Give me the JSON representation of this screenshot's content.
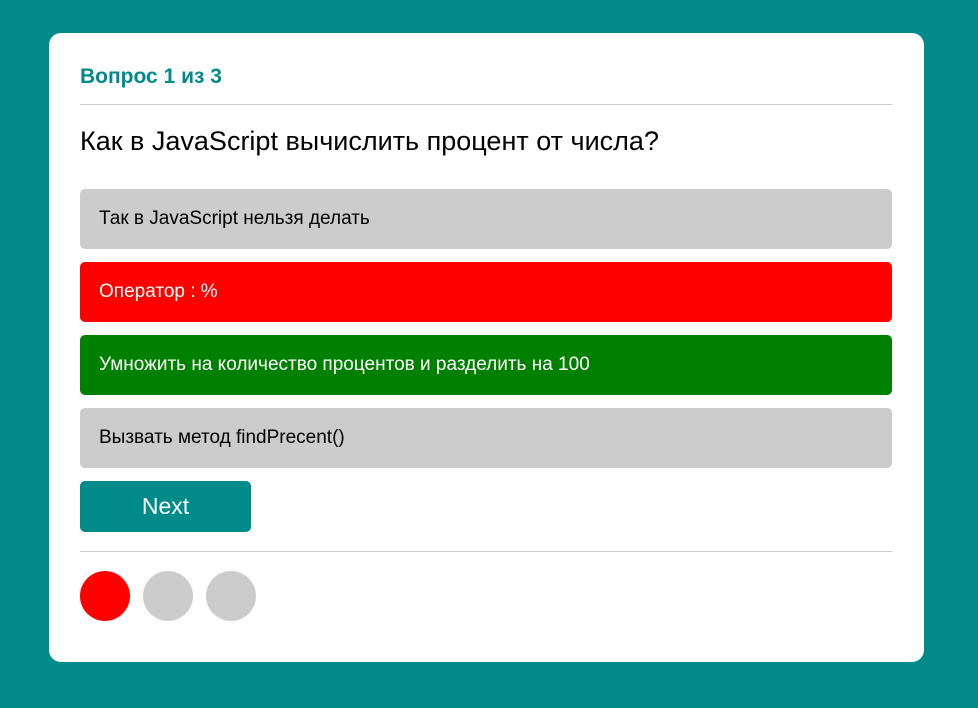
{
  "quiz": {
    "counter": "Вопрос 1 из 3",
    "question": "Как в JavaScript вычислить процент от числа?",
    "options": [
      {
        "label": "Так в JavaScript нельзя делать",
        "state": "neutral"
      },
      {
        "label": "Оператор : %",
        "state": "wrong"
      },
      {
        "label": "Умножить на количество процентов и разделить на 100",
        "state": "correct"
      },
      {
        "label": "Вызвать метод findPrecent()",
        "state": "neutral"
      }
    ],
    "next_label": "Next",
    "progress": [
      {
        "state": "wrong",
        "color": "#ff0000"
      },
      {
        "state": "pending",
        "color": "#cccccc"
      },
      {
        "state": "pending",
        "color": "#cccccc"
      }
    ]
  },
  "colors": {
    "background": "#008b8b",
    "accent": "#008b8b",
    "neutral": "#cccccc",
    "wrong": "#ff0000",
    "correct": "#008000"
  }
}
